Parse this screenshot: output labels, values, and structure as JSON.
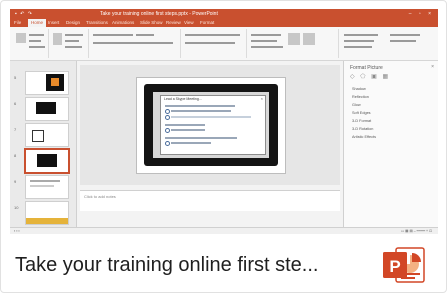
{
  "card": {
    "caption": "Take your training online first ste...",
    "app_icon": "powerpoint-icon"
  },
  "screenshot": {
    "window_title": "Take your training online first steps.pptx - PowerPoint",
    "ribbon_tabs": [
      "File",
      "Home",
      "Insert",
      "Design",
      "Transitions",
      "Animations",
      "Slide Show",
      "Review",
      "View",
      "Format"
    ],
    "notes_placeholder": "Click to add notes",
    "format_pane": {
      "title": "Format Picture",
      "items": [
        "Shadow",
        "Reflection",
        "Glow",
        "Soft Edges",
        "3-D Format",
        "3-D Rotation",
        "Artistic Effects"
      ]
    },
    "dialog_title": "Lead a Skype Meeting..."
  },
  "colors": {
    "brand": "#D24726",
    "ribbon": "#C9502F"
  }
}
